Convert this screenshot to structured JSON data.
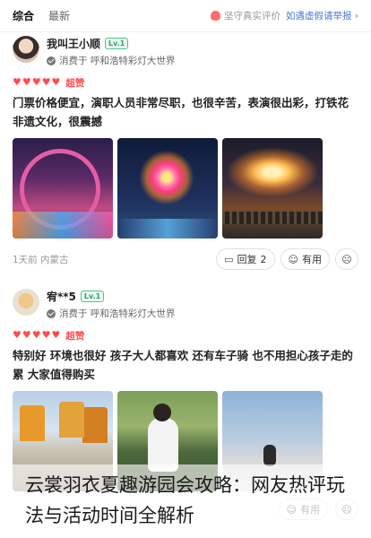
{
  "topbar": {
    "tabs": [
      {
        "label": "综合",
        "active": true
      },
      {
        "label": "最新",
        "active": false
      }
    ],
    "notice_text": "坚守真实评价",
    "notice_link": "如遇虚假请举报 ›"
  },
  "reviews": [
    {
      "username": "我叫王小顺",
      "level": "Lv.1",
      "consumed_at": "消费于 呼和浩特彩灯大世界",
      "hearts": 5,
      "rating_word": "超赞",
      "text": "门票价格便宜，演职人员非常尽职，也很辛苦，表演很出彩，打铁花非遗文化，很震撼",
      "time": "1天前",
      "location": "内蒙古",
      "reply_label": "回复",
      "reply_count": "2",
      "useful_label": "有用"
    },
    {
      "username": "宥**5",
      "level": "Lv.1",
      "consumed_at": "消费于 呼和浩特彩灯大世界",
      "hearts": 5,
      "rating_word": "超赞",
      "text": "特别好 环境也很好 孩子大人都喜欢 还有车子骑 也不用担心孩子走的累 大家值得购买",
      "useful_label": "有用"
    }
  ],
  "caption": "云裳羽衣夏趣游园会攻略：网友热评玩法与活动时间全解析",
  "colors": {
    "heart": "#ff4d4f",
    "level_badge": "#2e9f6a",
    "notice_link": "#4a7bd6"
  },
  "icons": {
    "notice": "shield-icon",
    "consumed": "check-circle-icon",
    "reply": "chat-bubble-icon",
    "useful": "smile-icon",
    "dislike": "frown-icon"
  }
}
